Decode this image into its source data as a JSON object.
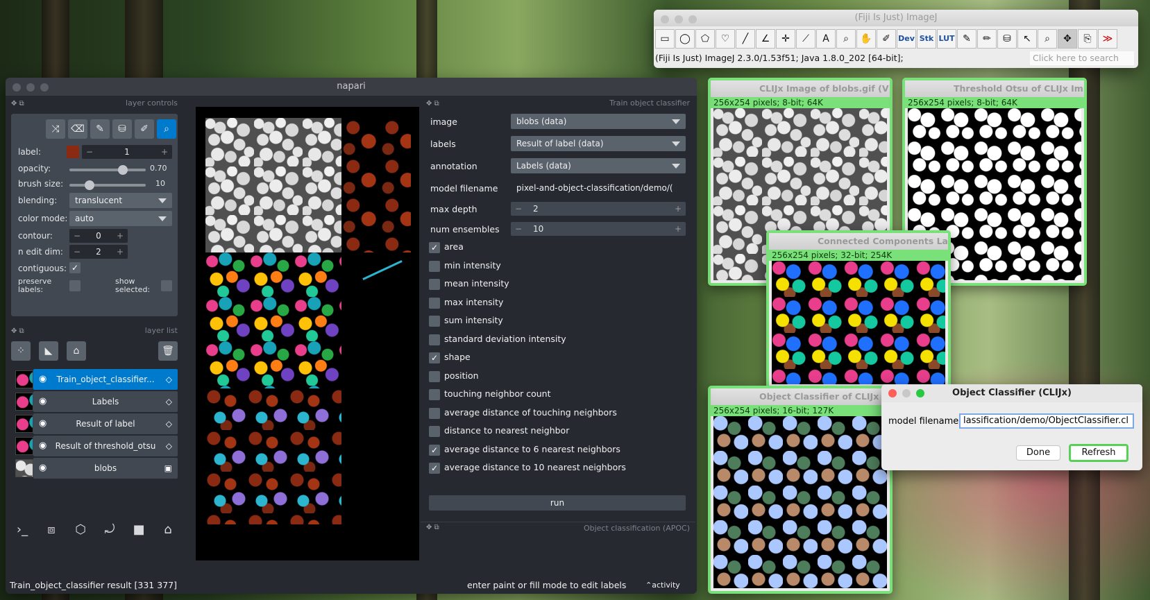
{
  "imagej": {
    "title": "(Fiji Is Just) ImageJ",
    "status": "(Fiji Is Just) ImageJ 2.3.0/1.53f51; Java 1.8.0_202 [64-bit];",
    "search_placeholder": "Click here to search",
    "tools": [
      "rectangle-icon",
      "oval-icon",
      "polygon-icon",
      "freehand-icon",
      "line-icon",
      "angle-icon",
      "multipoint-icon",
      "wand-icon",
      "text-icon",
      "magnifier-icon",
      "hand-icon",
      "dropper-icon",
      "Dev",
      "Stk",
      "LUT",
      "pencil-icon",
      "brush-icon",
      "flood-fill-icon",
      "arrow-tool-icon",
      "zoom-tool-icon",
      "move-icon",
      "script-icon",
      "more-icon"
    ]
  },
  "image_windows": {
    "blobs": {
      "title": "CLIJx Image of blobs.gif (V)",
      "info": "256x254 pixels; 8-bit; 64K"
    },
    "threshold": {
      "title": "Threshold Otsu of CLIJx Im...",
      "info": "256x254 pixels; 8-bit; 64K"
    },
    "connected": {
      "title": "Connected Components La...",
      "info": "256x254 pixels; 32-bit; 254K"
    },
    "object_classifier": {
      "title": "Object Classifier of CLIJx I...",
      "info": "256x254 pixels; 16-bit; 127K"
    }
  },
  "dialog": {
    "title": "Object Classifier (CLIJx)",
    "field_label": "model filename",
    "field_value": "lassification/demo/ObjectClassifier.cl",
    "done_label": "Done",
    "refresh_label": "Refresh"
  },
  "napari": {
    "title": "napari",
    "layer_controls_title": "layer controls",
    "layer_list_title": "layer list",
    "controls": {
      "label_label": "label:",
      "label_value": "1",
      "opacity_label": "opacity:",
      "opacity_value": "0.70",
      "opacity_level": 0.7,
      "brush_label": "brush size:",
      "brush_value": "10",
      "blending_label": "blending:",
      "blending_value": "translucent",
      "color_mode_label": "color mode:",
      "color_mode_value": "auto",
      "contour_label": "contour:",
      "contour_value": "0",
      "n_edit_label": "n edit dim:",
      "n_edit_value": "2",
      "contiguous_label": "contiguous:",
      "preserve_label": "preserve labels:",
      "show_selected_label": "show selected:"
    },
    "layers": [
      {
        "name": "Train_object_classifier...",
        "selected": true,
        "kind": "label"
      },
      {
        "name": "Labels",
        "selected": false,
        "kind": "label"
      },
      {
        "name": "Result of label",
        "selected": false,
        "kind": "label"
      },
      {
        "name": "Result of threshold_otsu",
        "selected": false,
        "kind": "label"
      },
      {
        "name": "blobs",
        "selected": false,
        "kind": "image"
      }
    ],
    "classifier": {
      "title": "Train object classifier",
      "image_label": "image",
      "image_value": "blobs (data)",
      "labels_label": "labels",
      "labels_value": "Result of label (data)",
      "annotation_label": "annotation",
      "annotation_value": "Labels (data)",
      "model_label": "model filename",
      "model_value": "pixel-and-object-classification/demo/(",
      "depth_label": "max depth",
      "depth_value": "2",
      "ensembles_label": "num ensembles",
      "ensembles_value": "10",
      "features": [
        {
          "label": "area",
          "checked": true
        },
        {
          "label": "min intensity",
          "checked": false
        },
        {
          "label": "mean intensity",
          "checked": false
        },
        {
          "label": "max intensity",
          "checked": false
        },
        {
          "label": "sum intensity",
          "checked": false
        },
        {
          "label": "standard deviation intensity",
          "checked": false
        },
        {
          "label": "shape",
          "checked": true
        },
        {
          "label": "position",
          "checked": false
        },
        {
          "label": "touching neighbor count",
          "checked": false
        },
        {
          "label": "average distance of touching neighbors",
          "checked": false
        },
        {
          "label": "distance to nearest neighbor",
          "checked": false
        },
        {
          "label": "average distance to 6 nearest neighbors",
          "checked": true
        },
        {
          "label": "average distance to 10 nearest neighbors",
          "checked": true
        }
      ],
      "run_label": "run"
    },
    "apoc_title": "Object classification (APOC)",
    "status_left": "Train_object_classifier result [331 377]",
    "status_center": "enter paint or fill mode to edit labels",
    "activity": "activity"
  }
}
